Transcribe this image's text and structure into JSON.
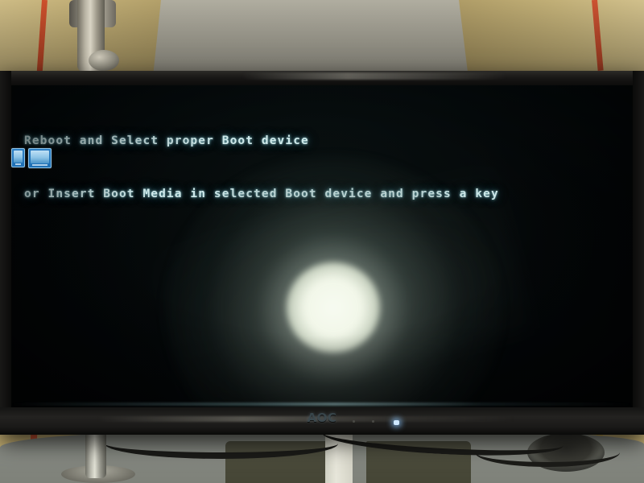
{
  "scene": {
    "description": "photo-of-monitor",
    "device_brand": "AOC"
  },
  "bios_message": {
    "line1": "Reboot and Select proper Boot device",
    "line2": "or Insert Boot Media in selected Boot device and press a key",
    "text_color": "#cfe9ea"
  },
  "monitor": {
    "brand_label": "AOC",
    "power_led_color": "#cfe8ff",
    "bezel_color": "#141413",
    "stickers": [
      {
        "name": "certification-sticker-1",
        "color": "#2d7fc4"
      },
      {
        "name": "certification-sticker-2",
        "color": "#2d7fc4"
      }
    ]
  },
  "environment": {
    "wall_color": "#a8a597",
    "wall_panel_color": "#cdb97e",
    "wall_stripe_color": "#cf4c2c",
    "desk_color": "#878a83",
    "mousepad_color": "#4a4a3a",
    "glare_color": "#f7fbf1"
  }
}
